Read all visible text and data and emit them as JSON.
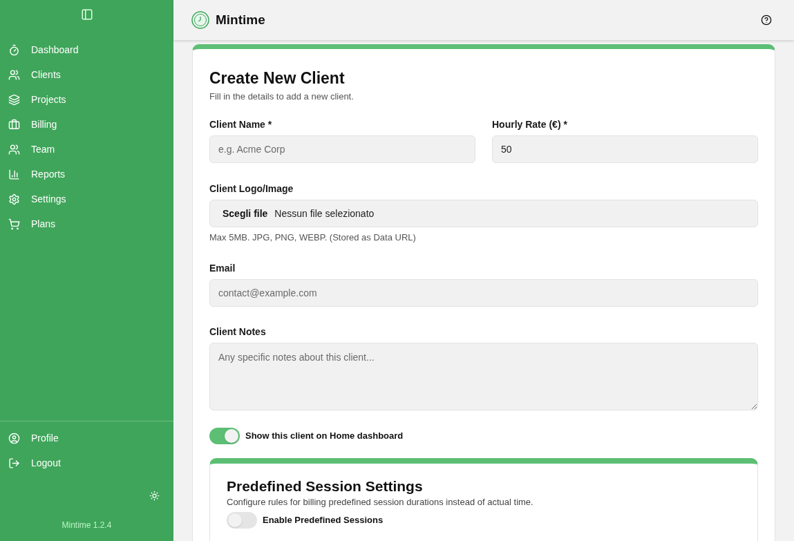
{
  "sidebar": {
    "items": [
      {
        "label": "Dashboard",
        "selected": false
      },
      {
        "label": "Clients",
        "selected": false
      },
      {
        "label": "Projects",
        "selected": false
      },
      {
        "label": "Billing",
        "selected": false
      },
      {
        "label": "Team",
        "selected": false
      },
      {
        "label": "Reports",
        "selected": false
      },
      {
        "label": "Settings",
        "selected": false
      },
      {
        "label": "Plans",
        "selected": false
      }
    ],
    "bottom_items": [
      {
        "label": "Profile"
      },
      {
        "label": "Logout"
      }
    ],
    "version": "Mintime 1.2.4"
  },
  "header": {
    "title": "Mintime"
  },
  "form": {
    "title": "Create New Client",
    "subtitle": "Fill in the details to add a new client.",
    "client_name": {
      "label": "Client Name *",
      "placeholder": "e.g. Acme Corp"
    },
    "hourly_rate": {
      "label": "Hourly Rate (€) *",
      "value": "50"
    },
    "logo": {
      "label": "Client Logo/Image",
      "button": "Scegli file",
      "status": "Nessun file selezionato",
      "hint": "Max 5MB. JPG, PNG, WEBP. (Stored as Data URL)"
    },
    "email": {
      "label": "Email",
      "placeholder": "contact@example.com"
    },
    "notes": {
      "label": "Client Notes",
      "placeholder": "Any specific notes about this client..."
    },
    "show_on_home": {
      "label": "Show this client on Home dashboard",
      "on": true
    },
    "session_settings": {
      "title": "Predefined Session Settings",
      "subtitle": "Configure rules for billing predefined session durations instead of actual time.",
      "enable": {
        "label": "Enable Predefined Sessions",
        "on": false
      }
    }
  }
}
